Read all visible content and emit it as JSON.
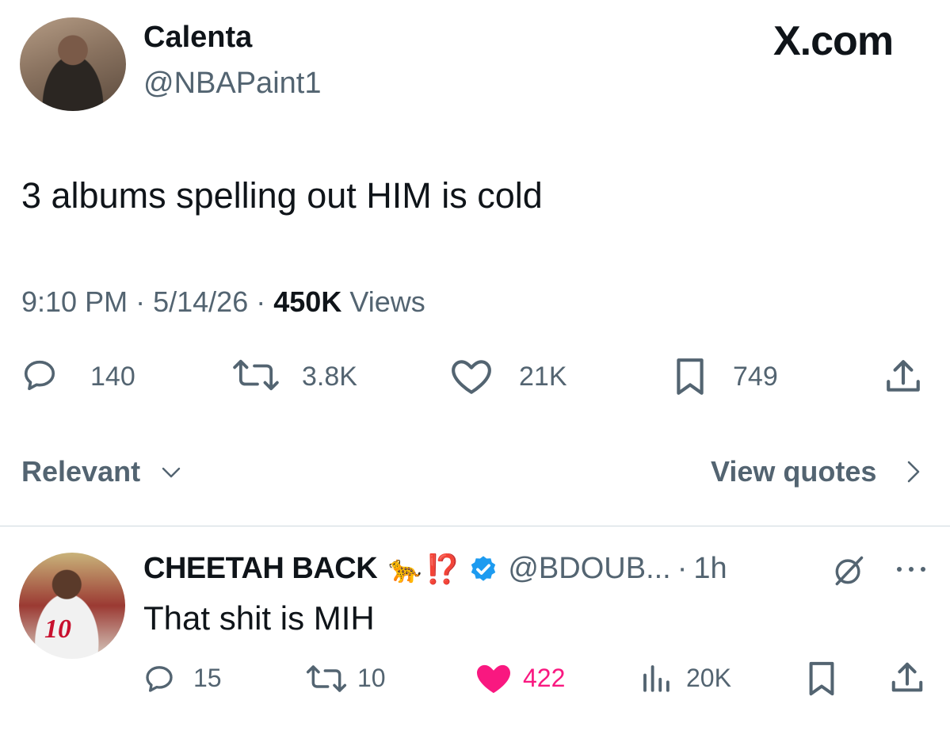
{
  "brand": {
    "watermark": "X.com"
  },
  "tweet": {
    "author_name": "Calenta",
    "author_handle": "@NBAPaint1",
    "text": "3 albums spelling out HIM is cold",
    "time": "9:10 PM",
    "date": "5/14/26",
    "views_count": "450K",
    "views_label": "Views",
    "separator": "·",
    "metrics": {
      "replies": "140",
      "reposts": "3.8K",
      "likes": "21K",
      "bookmarks": "749"
    }
  },
  "filter": {
    "sort_label": "Relevant",
    "view_quotes_label": "View quotes"
  },
  "reply": {
    "author_name": "CHEETAH BACK",
    "name_emoji": "🐆",
    "name_punct": "⁉️",
    "verified": true,
    "author_handle": "@BDOUB...",
    "separator": "·",
    "time": "1h",
    "jersey_number": "10",
    "text": "That shit is MIH",
    "metrics": {
      "replies": "15",
      "reposts": "10",
      "likes": "422",
      "views": "20K"
    },
    "liked": true
  },
  "colors": {
    "text": "#0f1419",
    "muted": "#536471",
    "like_active": "#f91880",
    "verified": "#1d9bf0",
    "exclaim": "#e0312b"
  },
  "icons": [
    "reply-icon",
    "repost-icon",
    "like-icon",
    "bookmark-icon",
    "share-icon",
    "chevron-down-icon",
    "chevron-right-icon",
    "verified-badge-icon",
    "grok-icon",
    "more-icon",
    "views-icon"
  ]
}
